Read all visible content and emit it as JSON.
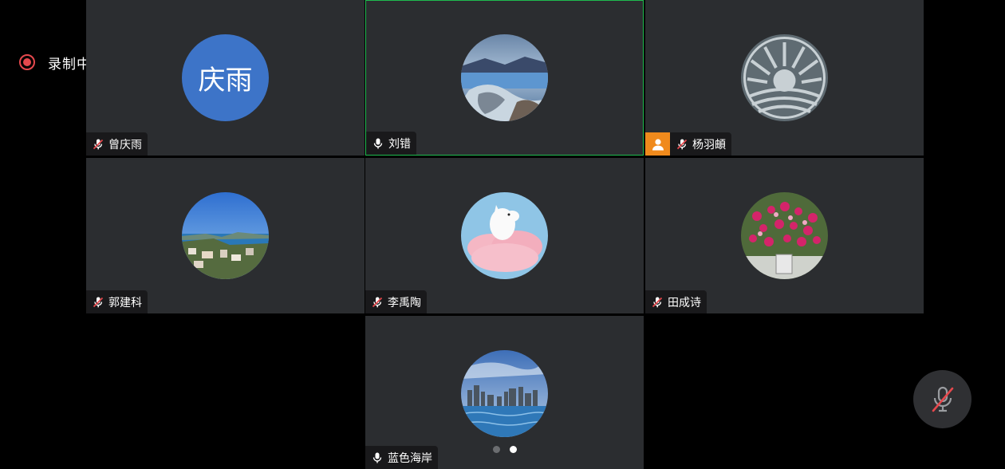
{
  "recording": {
    "label": "录制中",
    "color": "#e5484d"
  },
  "participants": [
    {
      "name": "曾庆雨",
      "mic": "muted",
      "avatar": "initials",
      "initials": "庆雨",
      "avatar_color": "#3d74c8"
    },
    {
      "name": "刘错",
      "mic": "on",
      "avatar": "photo-lake-icy-shore",
      "active_speaker": true
    },
    {
      "name": "杨羽頔",
      "mic": "muted",
      "avatar": "photo-sun-emblem",
      "host_badge": "person-icon"
    },
    {
      "name": "郭建科",
      "mic": "muted",
      "avatar": "photo-coastal-city"
    },
    {
      "name": "李禹陶",
      "mic": "muted",
      "avatar": "photo-moomin-cloud"
    },
    {
      "name": "田成诗",
      "mic": "muted",
      "avatar": "photo-pink-flowers"
    },
    {
      "name": "蓝色海岸",
      "mic": "on",
      "avatar": "photo-city-skyline-sea"
    }
  ],
  "pagination": {
    "pages": 2,
    "current": 2
  },
  "controls": {
    "mute_button_icon": "mic-muted-icon"
  },
  "colors": {
    "tile_bg": "#2b2d30",
    "active_border": "#1fbb4f",
    "badge": "#f08a1c"
  }
}
